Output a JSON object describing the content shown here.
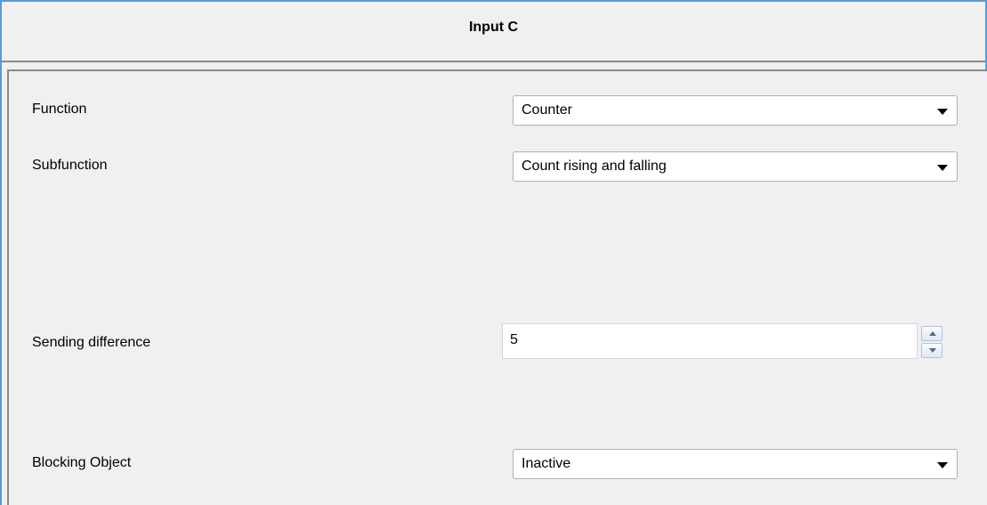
{
  "header": {
    "title": "Input C"
  },
  "fields": {
    "function": {
      "label": "Function",
      "value": "Counter"
    },
    "subfunction": {
      "label": "Subfunction",
      "value": "Count rising and falling"
    },
    "sending_difference": {
      "label": "Sending difference",
      "value": "5"
    },
    "blocking_object": {
      "label": "Blocking Object",
      "value": "Inactive"
    }
  },
  "colors": {
    "frame": "#5b9bd5",
    "background": "#f0f0f0",
    "field_background": "#ffffff"
  }
}
